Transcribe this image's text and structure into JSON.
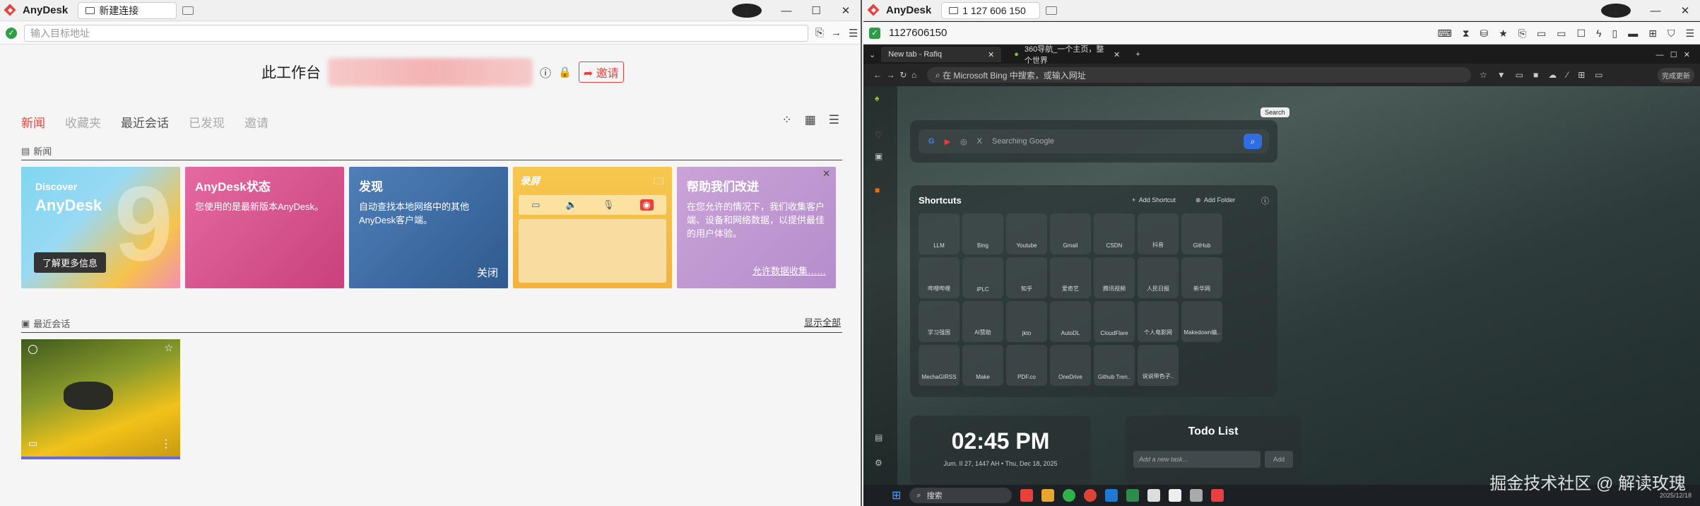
{
  "left": {
    "app_name": "AnyDesk",
    "tab_label": "新建连接",
    "address_placeholder": "输入目标地址",
    "workspace_title": "此工作台",
    "invite_label": "邀请",
    "nav_tabs": [
      "新闻",
      "收藏夹",
      "最近会话",
      "已发现",
      "邀请"
    ],
    "news_section": "新闻",
    "cards": {
      "discover_small": "Discover",
      "discover_big": "AnyDesk",
      "discover_num": "9",
      "learn_more": "了解更多信息",
      "status_title": "AnyDesk状态",
      "status_text": "您使用的是最新版本AnyDesk。",
      "find_title": "发现",
      "find_text": "自动查找本地网络中的其他AnyDesk客户端。",
      "find_close": "关闭",
      "record_title": "录屏",
      "help_title": "帮助我们改进",
      "help_text": "在您允许的情况下，我们收集客户端、设备和网络数据，以提供最佳的用户体验。",
      "help_allow": "允许数据收集……"
    },
    "recent_section": "最近会话",
    "show_all": "显示全部"
  },
  "right": {
    "app_name": "AnyDesk",
    "tab_label": "1 127 606 150",
    "remote_id": "1127606150",
    "browser": {
      "tab1": "New tab - Rafiq",
      "tab2": "360导航_一个主页，整个世界",
      "url_text": "在 Microsoft Bing 中搜索，或输入网址",
      "update_label": "完成更新",
      "search_tooltip": "Search",
      "search_placeholder": "Searching Google",
      "shortcuts_title": "Shortcuts",
      "add_shortcut": "Add Shortcut",
      "add_folder": "Add Folder",
      "shortcuts": [
        "LLM",
        "Bing",
        "Youtube",
        "Gmail",
        "CSDN",
        "抖音",
        "GitHub",
        "哔哩哔哩",
        "iPLC",
        "知乎",
        "爱奇艺",
        "腾讯视频",
        "人民日报",
        "新华网",
        "学习强国",
        "AI赞助",
        "jkto",
        "AutoDL",
        "CloudFlare",
        "个人电影网",
        "Makedown编..",
        "MechaGIRSS",
        "Make",
        "PDF.co",
        "OneDrive",
        "Github Tren..",
        "说说带色子.."
      ],
      "clock_time": "02:45 PM",
      "clock_date": "Jum. II 27, 1447 AH • Thu, Dec 18, 2025",
      "todo_title": "Todo List",
      "todo_placeholder": "Add a new task...",
      "todo_add": "Add"
    },
    "taskbar_search": "搜索",
    "taskbar_date": "2025/12/18"
  },
  "watermark": "掘金技术社区 @ 解读玫瑰"
}
